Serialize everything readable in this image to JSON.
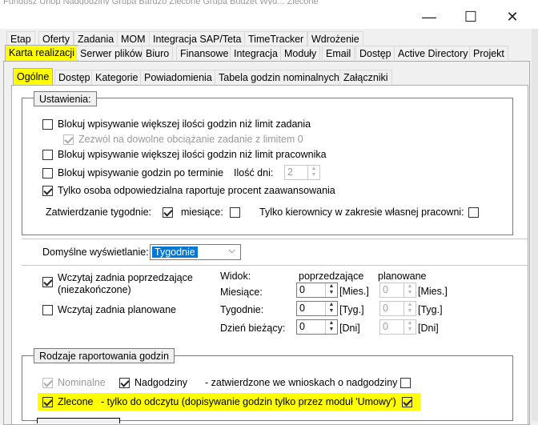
{
  "background_menu": "Fundusz  Urlop  Nadgodziny  Grupa  Bardzo  Zlecone  Grupa  Budżet  Wyd...  Zlecone",
  "window": {
    "minimize": "—",
    "maximize": "☐",
    "close": "✕"
  },
  "top_tabs_row1": [
    "Etap",
    "Oferty",
    "Zadania",
    "MOM",
    "Integracja SAP/Teta",
    "TimeTracker",
    "Wdrożenie"
  ],
  "top_tabs_row2": [
    "Karta realizacji",
    "Serwer plików",
    "Biuro",
    "Finansowe",
    "Integracja",
    "Moduły",
    "Email",
    "Dostęp",
    "Active Directory",
    "Projekt"
  ],
  "sub_tabs": [
    "Ogólne",
    "Dostęp",
    "Kategorie",
    "Powiadomienia",
    "Tabela godzin nominalnych",
    "Załączniki"
  ],
  "settings": {
    "title": "Ustawienia:",
    "block_task_limit": "Blokuj wpisywanie większej ilości godzin niż limit zadania",
    "allow_any_load": "Zezwól na dowolne obciążanie zadanie z limitem 0",
    "block_employee_limit": "Blokuj wpisywanie większej ilości godzin niż limit pracownika",
    "block_after_deadline": "Blokuj wpisywanie godzin po terminie",
    "days_label": "Ilość dni:",
    "days_value": "2",
    "only_responsible": "Tylko osoba odpowiedzialna raportuje procent zaawansowania",
    "approve_weekly": "Zatwierdzanie tygodnie:",
    "months": "miesiące:",
    "only_managers": "Tylko kierownicy w zakresie własnej pracowni:"
  },
  "display": {
    "label": "Domyślne wyświetlanie:",
    "value": "Tygodnie"
  },
  "load": {
    "load_previous": "Wczytaj zadnia poprzedzające",
    "load_previous_note": "(niezakończone)",
    "load_planned": "Wczytaj zadnia planowane",
    "view": "Widok:",
    "previous": "poprzedzające",
    "planned": "planowane",
    "rows": [
      {
        "label": "Miesiące:",
        "prev": "0",
        "prev_unit": "[Mies.]",
        "plan": "0",
        "plan_unit": "[Mies.]"
      },
      {
        "label": "Tygodnie:",
        "prev": "0",
        "prev_unit": "[Tyg.]",
        "plan": "0",
        "plan_unit": "[Tyg.]"
      },
      {
        "label": "Dzień bieżący:",
        "prev": "0",
        "prev_unit": "[Dni]",
        "plan": "0",
        "plan_unit": "[Dni]"
      }
    ]
  },
  "reporting": {
    "title": "Rodzaje raportowania godzin",
    "nominal": "Nominalne",
    "overtime": "Nadgodziny",
    "overtime_note": "- zatwierdzone we wnioskach o nadgodziny",
    "ordered": "Zlecone",
    "ordered_note": "- tylko do odczytu (dopisywanie godzin tylko przez moduł 'Umowy')"
  },
  "colors": {
    "highlight": "#ffff00",
    "selection": "#0078d7"
  }
}
